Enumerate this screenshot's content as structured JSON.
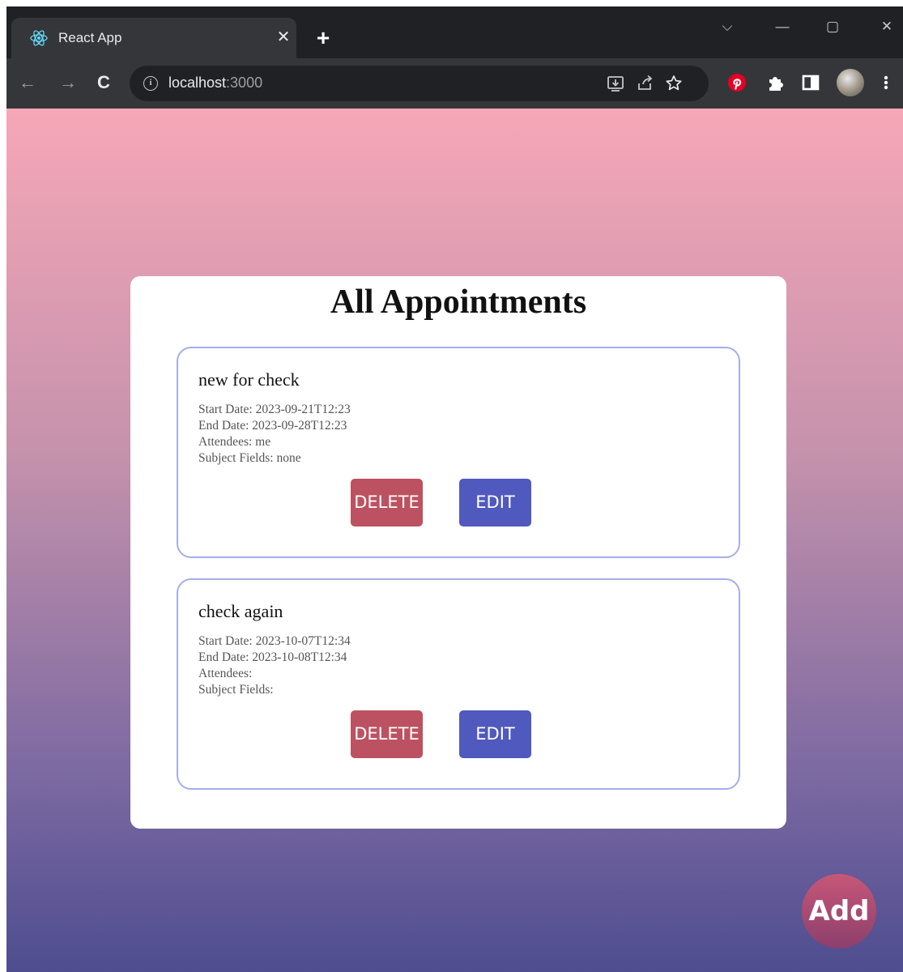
{
  "browser": {
    "tab": {
      "title": "React App",
      "close_glyph": "✕"
    },
    "new_tab_glyph": "+",
    "window_controls": {
      "dropdown": "⌵",
      "minimize": "—",
      "maximize": "▢",
      "close": "✕"
    },
    "nav": {
      "back": "←",
      "forward": "→",
      "reload": "C"
    },
    "address": {
      "host": "localhost",
      "port": ":3000",
      "info_glyph": "i"
    },
    "icons": [
      "install-icon",
      "share-icon",
      "bookmark-star-icon",
      "pinterest-icon",
      "extensions-icon",
      "side-panel-icon",
      "profile-avatar-icon",
      "menu-kebab-icon"
    ],
    "colors": {
      "frame": "#202124",
      "toolbar": "#35363a"
    }
  },
  "page": {
    "title": "All Appointments",
    "appointments": [
      {
        "title": "new for check",
        "start_label": "Start Date: 2023-09-21T12:23",
        "end_label": "End Date: 2023-09-28T12:23",
        "attendees_label": "Attendees: me",
        "subject_label": "Subject Fields: none",
        "delete_label": "DELETE",
        "edit_label": "EDIT"
      },
      {
        "title": "check again",
        "start_label": "Start Date: 2023-10-07T12:34",
        "end_label": "End Date: 2023-10-08T12:34",
        "attendees_label": "Attendees:",
        "subject_label": "Subject Fields:",
        "delete_label": "DELETE",
        "edit_label": "EDIT"
      }
    ],
    "add_label": "Add",
    "colors": {
      "delete": "#bc5261",
      "edit": "#5059bd",
      "card_border": "#a5aee9",
      "gradient_top": "#f6a7b7",
      "gradient_bottom": "#4e4d8f"
    }
  }
}
